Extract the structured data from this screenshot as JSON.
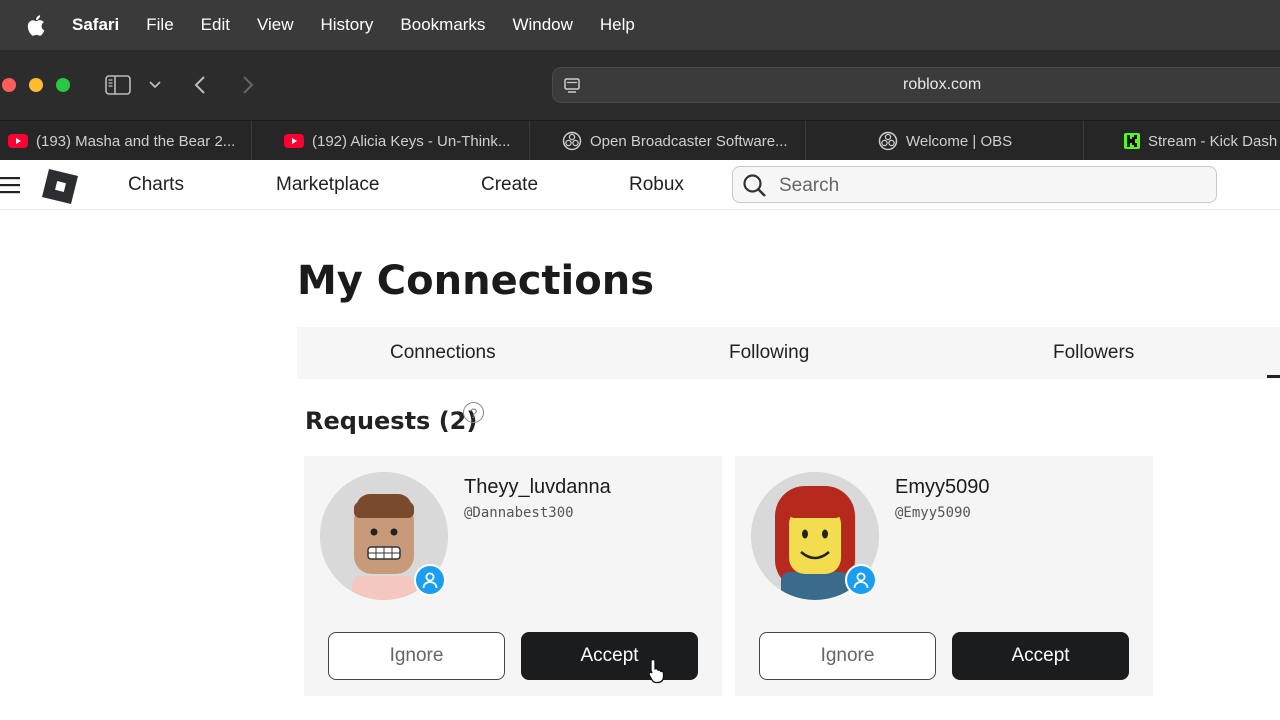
{
  "menubar": {
    "app": "Safari",
    "items": [
      "File",
      "Edit",
      "View",
      "History",
      "Bookmarks",
      "Window",
      "Help"
    ]
  },
  "toolbar": {
    "url": "roblox.com"
  },
  "tabs": [
    {
      "label": "(193) Masha and the Bear 2...",
      "icon": "youtube-icon"
    },
    {
      "label": "(192) Alicia Keys - Un-Think...",
      "icon": "youtube-icon"
    },
    {
      "label": "Open Broadcaster Software...",
      "icon": "obs-icon"
    },
    {
      "label": "Welcome | OBS",
      "icon": "obs-icon"
    },
    {
      "label": "Stream - Kick Dash",
      "icon": "kick-icon"
    }
  ],
  "nav": {
    "links": [
      "Charts",
      "Marketplace",
      "Create",
      "Robux"
    ],
    "search_placeholder": "Search"
  },
  "page": {
    "title": "My Connections",
    "tabs": [
      "Connections",
      "Following",
      "Followers"
    ],
    "requests_title": "Requests (2)",
    "help_symbol": "?"
  },
  "requests": [
    {
      "name": "Theyy_luvdanna",
      "handle": "@Dannabest300",
      "ignore": "Ignore",
      "accept": "Accept"
    },
    {
      "name": "Emyy5090",
      "handle": "@Emyy5090",
      "ignore": "Ignore",
      "accept": "Accept"
    }
  ],
  "colors": {
    "accept_bg": "#1b1c1e",
    "badge": "#1a9ff0",
    "menubar": "#3a3a3a"
  }
}
